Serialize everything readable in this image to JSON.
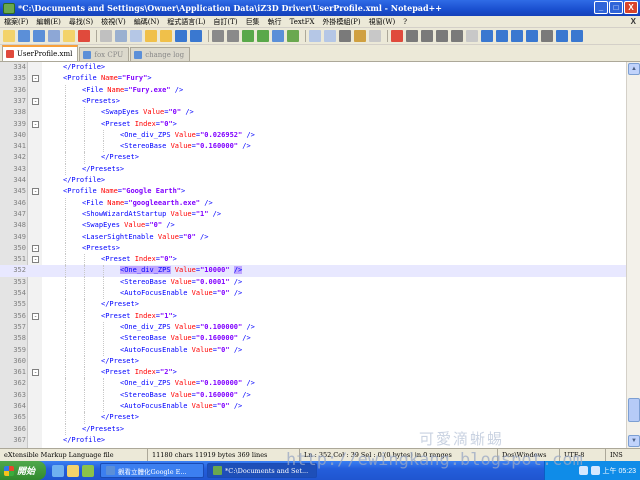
{
  "window": {
    "title": "*C:\\Documents and Settings\\Owner\\Application Data\\iZ3D Driver\\UserProfile.xml - Notepad++",
    "minimize": "_",
    "maximize": "□",
    "close": "X"
  },
  "menu": {
    "items": [
      "檔案(F)",
      "編輯(E)",
      "尋找(S)",
      "檢視(V)",
      "編碼(N)",
      "程式語言(L)",
      "自訂(T)",
      "巨集",
      "執行",
      "TextFX",
      "外掛模組(P)",
      "視窗(W)",
      "?"
    ],
    "close": "X"
  },
  "toolbar": {
    "button_colors": [
      "#f3d36b",
      "#5b8fd8",
      "#5b8fd8",
      "#8da7d6",
      "#f3d36b",
      "#e04a3c",
      "#c0c0c0",
      "#9ab0d0",
      "#b5c7e6",
      "#f0c04a",
      "#f0c04a",
      "#3a78d0",
      "#3a78d0",
      "#8a8a8a",
      "#8a8a8a",
      "#59a84a",
      "#59a84a",
      "#5b8fd8",
      "#6aa84f",
      "#b5c7e6",
      "#b5c7e6",
      "#7a7a7a",
      "#d0a040",
      "#c8c8c8",
      "#e04a3c",
      "#7a7a7a",
      "#7a7a7a",
      "#7a7a7a",
      "#7a7a7a",
      "#c8c8c8",
      "#3a78d0",
      "#3a78d0",
      "#3a78d0",
      "#3a78d0",
      "#7a7a7a",
      "#3a78d0",
      "#3a78d0"
    ]
  },
  "tabs": [
    {
      "label": "UserProfile.xml",
      "active": true
    },
    {
      "label": "fox CPU",
      "active": false
    },
    {
      "label": "change log",
      "active": false
    }
  ],
  "editor": {
    "lines": [
      {
        "num": "334",
        "indent": 2,
        "fold": "",
        "tokens": [
          {
            "t": "tag",
            "v": "</Profile>"
          }
        ]
      },
      {
        "num": "335",
        "indent": 2,
        "fold": "-",
        "tokens": [
          {
            "t": "tag",
            "v": "<Profile "
          },
          {
            "t": "attr",
            "v": "Name"
          },
          {
            "t": "tag",
            "v": "="
          },
          {
            "t": "str",
            "v": "\"Fury\""
          },
          {
            "t": "tag",
            "v": ">"
          }
        ]
      },
      {
        "num": "336",
        "indent": 4,
        "fold": "",
        "tokens": [
          {
            "t": "tag",
            "v": "<File "
          },
          {
            "t": "attr",
            "v": "Name"
          },
          {
            "t": "tag",
            "v": "="
          },
          {
            "t": "str",
            "v": "\"Fury.exe\""
          },
          {
            "t": "tag",
            "v": " />"
          }
        ]
      },
      {
        "num": "337",
        "indent": 4,
        "fold": "-",
        "tokens": [
          {
            "t": "tag",
            "v": "<Presets>"
          }
        ]
      },
      {
        "num": "338",
        "indent": 6,
        "fold": "",
        "tokens": [
          {
            "t": "tag",
            "v": "<SwapEyes "
          },
          {
            "t": "attr",
            "v": "Value"
          },
          {
            "t": "tag",
            "v": "="
          },
          {
            "t": "str",
            "v": "\"0\""
          },
          {
            "t": "tag",
            "v": " />"
          }
        ]
      },
      {
        "num": "339",
        "indent": 6,
        "fold": "-",
        "tokens": [
          {
            "t": "tag",
            "v": "<Preset "
          },
          {
            "t": "attr",
            "v": "Index"
          },
          {
            "t": "tag",
            "v": "="
          },
          {
            "t": "str",
            "v": "\"0\""
          },
          {
            "t": "tag",
            "v": ">"
          }
        ]
      },
      {
        "num": "340",
        "indent": 8,
        "fold": "",
        "tokens": [
          {
            "t": "tag",
            "v": "<One_div_ZPS "
          },
          {
            "t": "attr",
            "v": "Value"
          },
          {
            "t": "tag",
            "v": "="
          },
          {
            "t": "str",
            "v": "\"0.026952\""
          },
          {
            "t": "tag",
            "v": " />"
          }
        ]
      },
      {
        "num": "341",
        "indent": 8,
        "fold": "",
        "tokens": [
          {
            "t": "tag",
            "v": "<StereoBase "
          },
          {
            "t": "attr",
            "v": "Value"
          },
          {
            "t": "tag",
            "v": "="
          },
          {
            "t": "str",
            "v": "\"0.160000\""
          },
          {
            "t": "tag",
            "v": " />"
          }
        ]
      },
      {
        "num": "342",
        "indent": 6,
        "fold": "",
        "tokens": [
          {
            "t": "tag",
            "v": "</Preset>"
          }
        ]
      },
      {
        "num": "343",
        "indent": 4,
        "fold": "",
        "tokens": [
          {
            "t": "tag",
            "v": "</Presets>"
          }
        ]
      },
      {
        "num": "344",
        "indent": 2,
        "fold": "",
        "tokens": [
          {
            "t": "tag",
            "v": "</Profile>"
          }
        ]
      },
      {
        "num": "345",
        "indent": 2,
        "fold": "-",
        "tokens": [
          {
            "t": "tag",
            "v": "<Profile "
          },
          {
            "t": "attr",
            "v": "Name"
          },
          {
            "t": "tag",
            "v": "="
          },
          {
            "t": "str",
            "v": "\"Google Earth\""
          },
          {
            "t": "tag",
            "v": ">"
          }
        ]
      },
      {
        "num": "346",
        "indent": 4,
        "fold": "",
        "tokens": [
          {
            "t": "tag",
            "v": "<File "
          },
          {
            "t": "attr",
            "v": "Name"
          },
          {
            "t": "tag",
            "v": "="
          },
          {
            "t": "str",
            "v": "\"googleearth.exe\""
          },
          {
            "t": "tag",
            "v": " />"
          }
        ]
      },
      {
        "num": "347",
        "indent": 4,
        "fold": "",
        "tokens": [
          {
            "t": "tag",
            "v": "<ShowWizardAtStartup "
          },
          {
            "t": "attr",
            "v": "Value"
          },
          {
            "t": "tag",
            "v": "="
          },
          {
            "t": "str",
            "v": "\"1\""
          },
          {
            "t": "tag",
            "v": " />"
          }
        ]
      },
      {
        "num": "348",
        "indent": 4,
        "fold": "",
        "tokens": [
          {
            "t": "tag",
            "v": "<SwapEyes "
          },
          {
            "t": "attr",
            "v": "Value"
          },
          {
            "t": "tag",
            "v": "="
          },
          {
            "t": "str",
            "v": "\"0\""
          },
          {
            "t": "tag",
            "v": " />"
          }
        ]
      },
      {
        "num": "349",
        "indent": 4,
        "fold": "",
        "tokens": [
          {
            "t": "tag",
            "v": "<LaserSightEnable "
          },
          {
            "t": "attr",
            "v": "Value"
          },
          {
            "t": "tag",
            "v": "="
          },
          {
            "t": "str",
            "v": "\"0\""
          },
          {
            "t": "tag",
            "v": " />"
          }
        ]
      },
      {
        "num": "350",
        "indent": 4,
        "fold": "-",
        "tokens": [
          {
            "t": "tag",
            "v": "<Presets>"
          }
        ]
      },
      {
        "num": "351",
        "indent": 6,
        "fold": "-",
        "tokens": [
          {
            "t": "tag",
            "v": "<Preset "
          },
          {
            "t": "attr",
            "v": "Index"
          },
          {
            "t": "tag",
            "v": "="
          },
          {
            "t": "str",
            "v": "\"0\""
          },
          {
            "t": "tag",
            "v": ">"
          }
        ]
      },
      {
        "num": "352",
        "indent": 8,
        "fold": "",
        "current": true,
        "tokens": [
          {
            "t": "tag hl",
            "v": "<One_div_ZPS"
          },
          {
            "t": "tag",
            "v": " "
          },
          {
            "t": "attr",
            "v": "Value"
          },
          {
            "t": "tag",
            "v": "="
          },
          {
            "t": "str",
            "v": "\"10000\""
          },
          {
            "t": "tag",
            "v": " "
          },
          {
            "t": "tag hl",
            "v": "/>"
          }
        ]
      },
      {
        "num": "353",
        "indent": 8,
        "fold": "",
        "tokens": [
          {
            "t": "tag",
            "v": "<StereoBase "
          },
          {
            "t": "attr",
            "v": "Value"
          },
          {
            "t": "tag",
            "v": "="
          },
          {
            "t": "str",
            "v": "\"0.0001\""
          },
          {
            "t": "tag",
            "v": " />"
          }
        ]
      },
      {
        "num": "354",
        "indent": 8,
        "fold": "",
        "tokens": [
          {
            "t": "tag",
            "v": "<AutoFocusEnable "
          },
          {
            "t": "attr",
            "v": "Value"
          },
          {
            "t": "tag",
            "v": "="
          },
          {
            "t": "str",
            "v": "\"0\""
          },
          {
            "t": "tag",
            "v": " />"
          }
        ]
      },
      {
        "num": "355",
        "indent": 6,
        "fold": "",
        "tokens": [
          {
            "t": "tag",
            "v": "</Preset>"
          }
        ]
      },
      {
        "num": "356",
        "indent": 6,
        "fold": "-",
        "tokens": [
          {
            "t": "tag",
            "v": "<Preset "
          },
          {
            "t": "attr",
            "v": "Index"
          },
          {
            "t": "tag",
            "v": "="
          },
          {
            "t": "str",
            "v": "\"1\""
          },
          {
            "t": "tag",
            "v": ">"
          }
        ]
      },
      {
        "num": "357",
        "indent": 8,
        "fold": "",
        "tokens": [
          {
            "t": "tag",
            "v": "<One_div_ZPS "
          },
          {
            "t": "attr",
            "v": "Value"
          },
          {
            "t": "tag",
            "v": "="
          },
          {
            "t": "str",
            "v": "\"0.100000\""
          },
          {
            "t": "tag",
            "v": " />"
          }
        ]
      },
      {
        "num": "358",
        "indent": 8,
        "fold": "",
        "tokens": [
          {
            "t": "tag",
            "v": "<StereoBase "
          },
          {
            "t": "attr",
            "v": "Value"
          },
          {
            "t": "tag",
            "v": "="
          },
          {
            "t": "str",
            "v": "\"0.160000\""
          },
          {
            "t": "tag",
            "v": " />"
          }
        ]
      },
      {
        "num": "359",
        "indent": 8,
        "fold": "",
        "tokens": [
          {
            "t": "tag",
            "v": "<AutoFocusEnable "
          },
          {
            "t": "attr",
            "v": "Value"
          },
          {
            "t": "tag",
            "v": "="
          },
          {
            "t": "str",
            "v": "\"0\""
          },
          {
            "t": "tag",
            "v": " />"
          }
        ]
      },
      {
        "num": "360",
        "indent": 6,
        "fold": "",
        "tokens": [
          {
            "t": "tag",
            "v": "</Preset>"
          }
        ]
      },
      {
        "num": "361",
        "indent": 6,
        "fold": "-",
        "tokens": [
          {
            "t": "tag",
            "v": "<Preset "
          },
          {
            "t": "attr",
            "v": "Index"
          },
          {
            "t": "tag",
            "v": "="
          },
          {
            "t": "str",
            "v": "\"2\""
          },
          {
            "t": "tag",
            "v": ">"
          }
        ]
      },
      {
        "num": "362",
        "indent": 8,
        "fold": "",
        "tokens": [
          {
            "t": "tag",
            "v": "<One_div_ZPS "
          },
          {
            "t": "attr",
            "v": "Value"
          },
          {
            "t": "tag",
            "v": "="
          },
          {
            "t": "str",
            "v": "\"0.100000\""
          },
          {
            "t": "tag",
            "v": " />"
          }
        ]
      },
      {
        "num": "363",
        "indent": 8,
        "fold": "",
        "tokens": [
          {
            "t": "tag",
            "v": "<StereoBase "
          },
          {
            "t": "attr",
            "v": "Value"
          },
          {
            "t": "tag",
            "v": "="
          },
          {
            "t": "str",
            "v": "\"0.160000\""
          },
          {
            "t": "tag",
            "v": " />"
          }
        ]
      },
      {
        "num": "364",
        "indent": 8,
        "fold": "",
        "tokens": [
          {
            "t": "tag",
            "v": "<AutoFocusEnable "
          },
          {
            "t": "attr",
            "v": "Value"
          },
          {
            "t": "tag",
            "v": "="
          },
          {
            "t": "str",
            "v": "\"0\""
          },
          {
            "t": "tag",
            "v": " />"
          }
        ]
      },
      {
        "num": "365",
        "indent": 6,
        "fold": "",
        "tokens": [
          {
            "t": "tag",
            "v": "</Preset>"
          }
        ]
      },
      {
        "num": "366",
        "indent": 4,
        "fold": "",
        "tokens": [
          {
            "t": "tag",
            "v": "</Presets>"
          }
        ]
      },
      {
        "num": "367",
        "indent": 2,
        "fold": "",
        "tokens": [
          {
            "t": "tag",
            "v": "</Profile>"
          }
        ]
      }
    ]
  },
  "scrollbar": {
    "up": "▲",
    "down": "▼"
  },
  "status": {
    "language": "eXtensible Markup Language file",
    "length": "11180 chars  11919 bytes  369 lines",
    "position": "Ln : 352   Col : 39   Sel : 0 (0 bytes) in 0 ranges",
    "eol": "Dos\\Windows",
    "encoding": "UTF-8",
    "mode": "INS"
  },
  "taskbar": {
    "start": "開始",
    "tasks": [
      {
        "label": "觀看立體化Google E...",
        "active": false
      },
      {
        "label": "*C:\\Documents and Set...",
        "active": true
      }
    ],
    "clock": "上午 05:23"
  },
  "watermark": {
    "cn": "可愛滴蜥蜴",
    "url": "http://ewingkang.blogspot.com"
  },
  "colors": {
    "tag": "#0000ff",
    "attr": "#ff0000",
    "string": "#8000ff",
    "match_highlight": "#c0a7ff",
    "current_line": "#e8e8ff"
  }
}
